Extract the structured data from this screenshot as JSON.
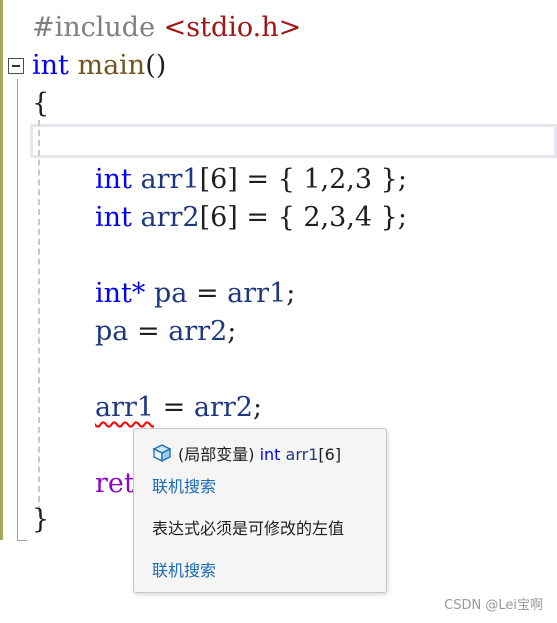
{
  "code": {
    "line1_pre": "#include",
    "line1_inc": "<stdio.h>",
    "line2_kw": "int",
    "line2_fn": "main",
    "line2_punc": "()",
    "line3": "{",
    "line5_kw": "int",
    "line5_var": "arr1",
    "line5_rest": "[6] = { 1,2,3 };",
    "line6_kw": "int",
    "line6_var": "arr2",
    "line6_rest": "[6] = { 2,3,4 };",
    "line8_kw": "int*",
    "line8_var1": "pa",
    "line8_eq": " = ",
    "line8_var2": "arr1",
    "line8_end": ";",
    "line9_var1": "pa",
    "line9_eq": " = ",
    "line9_var2": "arr2",
    "line9_end": ";",
    "line11_var1": "arr1",
    "line11_eq": " = ",
    "line11_var2": "arr2",
    "line11_end": ";",
    "line13_ret": "ret",
    "line14": "}"
  },
  "tooltip": {
    "scope": "(局部变量)",
    "type_kw": "int",
    "var_name": "arr1",
    "dims": "[6]",
    "link1": "联机搜索",
    "error_message": "表达式必须是可修改的左值",
    "link2": "联机搜索"
  },
  "watermark": "CSDN @Lei宝啊",
  "colors": {
    "keyword": "#0000ff",
    "variable": "#1f377f",
    "function": "#74531f",
    "include_string": "#a31515",
    "preprocessor": "#808080",
    "return_keyword": "#8f08c4",
    "error_squiggle": "#ff0000",
    "link": "#1a6bb3"
  }
}
